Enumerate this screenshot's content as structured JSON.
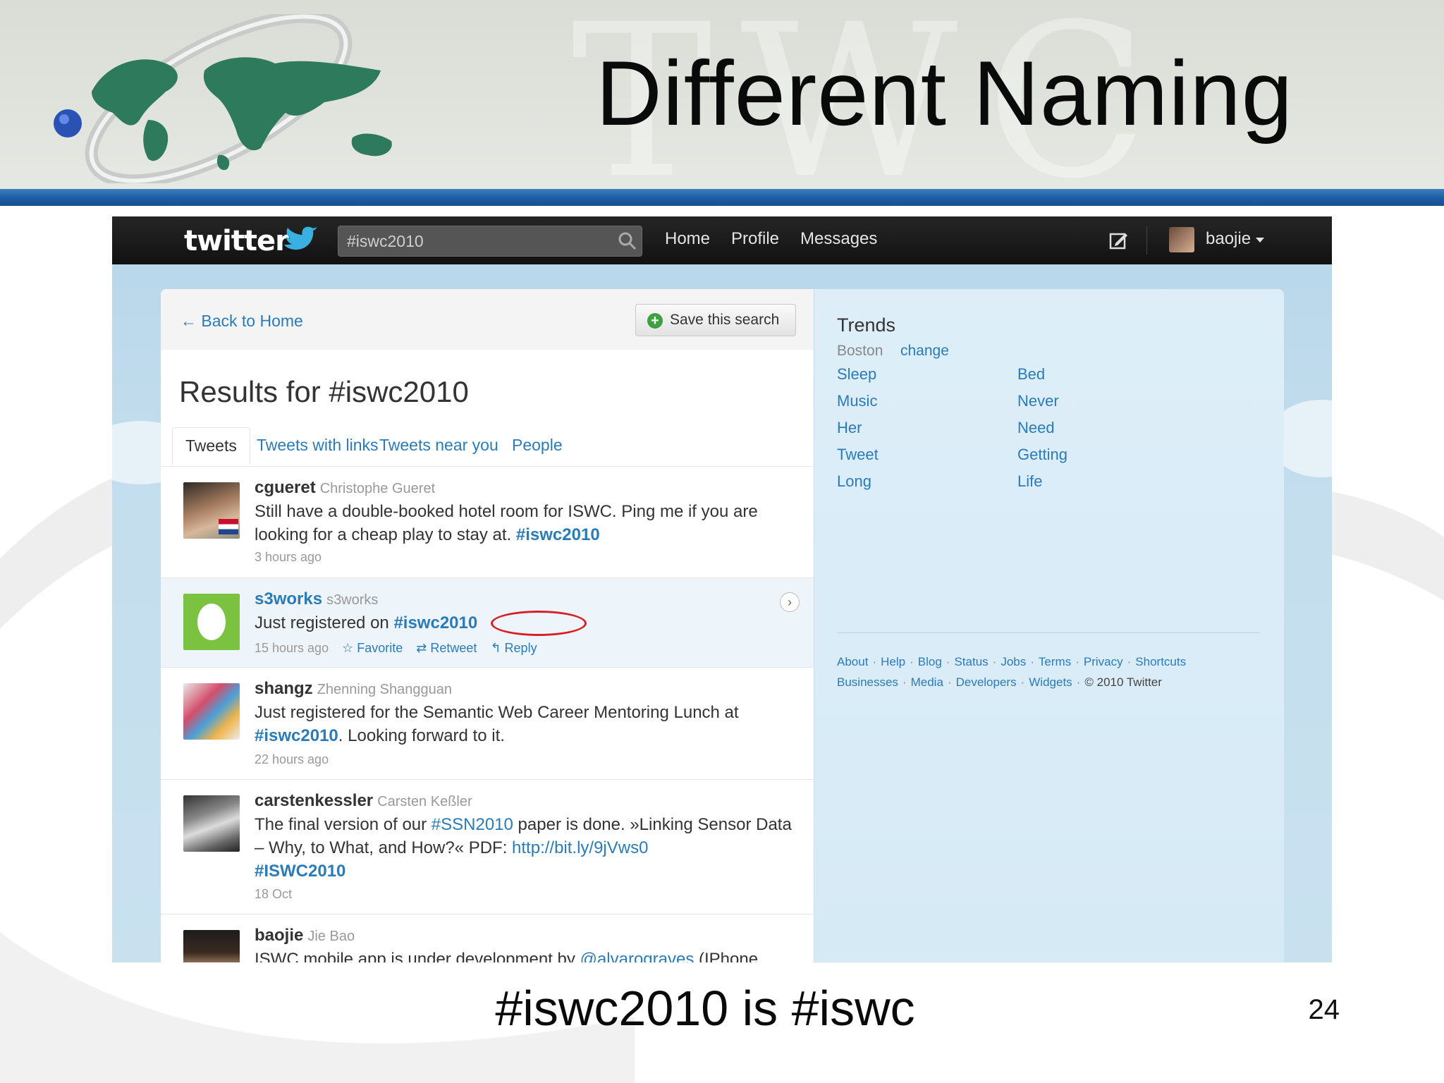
{
  "slide": {
    "title": "Different Naming",
    "caption": "#iswc2010 is #iswc",
    "slide_number": "24"
  },
  "topbar": {
    "logo": "twitter",
    "search_value": "#iswc2010",
    "nav": [
      "Home",
      "Profile",
      "Messages"
    ],
    "user": "baojie"
  },
  "main": {
    "back_link": "← Back to Home",
    "save_button": "Save this search",
    "results_title": "Results for #iswc2010",
    "tabs": [
      "Tweets",
      "Tweets with links",
      "Tweets near you",
      "People"
    ],
    "active_tab": "Tweets"
  },
  "tweets": [
    {
      "user": "cgueret",
      "real_name": "Christophe Gueret",
      "text_before": "Still have a double-booked hotel room for ISWC. Ping me if you are looking for a cheap play to stay at. ",
      "hashtag": "#iswc2010",
      "time": "3 hours ago"
    },
    {
      "user": "s3works",
      "real_name": "s3works",
      "text_before": "Just registered on ",
      "hashtag": "#iswc2010",
      "time": "15 hours ago",
      "actions": [
        "Favorite",
        "Retweet",
        "Reply"
      ]
    },
    {
      "user": "shangz",
      "real_name": "Zhenning Shangguan",
      "text_before": "Just registered for the Semantic Web Career Mentoring Lunch at ",
      "hashtag": "#iswc2010",
      "text_after": ". Looking forward to it.",
      "time": "22 hours ago"
    },
    {
      "user": "carstenkessler",
      "real_name": "Carsten Keßler",
      "text_before": "The final version of our ",
      "link_tag": "#SSN2010",
      "text_middle": " paper is done. »Linking Sensor Data – Why, to What, and How?« PDF: ",
      "url": "http://bit.ly/9jVws0",
      "hashtag": "#ISWC2010",
      "time": "18 Oct"
    },
    {
      "user": "baojie",
      "real_name": "Jie Bao",
      "text_before": "ISWC mobile app is under development by ",
      "mention": "@alvarograves",
      "text_after": " (IPhone"
    }
  ],
  "sidebar": {
    "trends_title": "Trends",
    "location": "Boston",
    "change_link": "change",
    "trends_left": [
      "Sleep",
      "Music",
      "Her",
      "Tweet",
      "Long"
    ],
    "trends_right": [
      "Bed",
      "Never",
      "Need",
      "Getting",
      "Life"
    ],
    "footer_row1": [
      "About",
      "Help",
      "Blog",
      "Status",
      "Jobs",
      "Terms",
      "Privacy",
      "Shortcuts"
    ],
    "footer_row2": [
      "Businesses",
      "Media",
      "Developers",
      "Widgets"
    ],
    "copyright": "© 2010 Twitter"
  },
  "colors": {
    "link": "#2b7bb9",
    "annotation": "#d81e26",
    "header_bar": "#1d5ea7"
  }
}
